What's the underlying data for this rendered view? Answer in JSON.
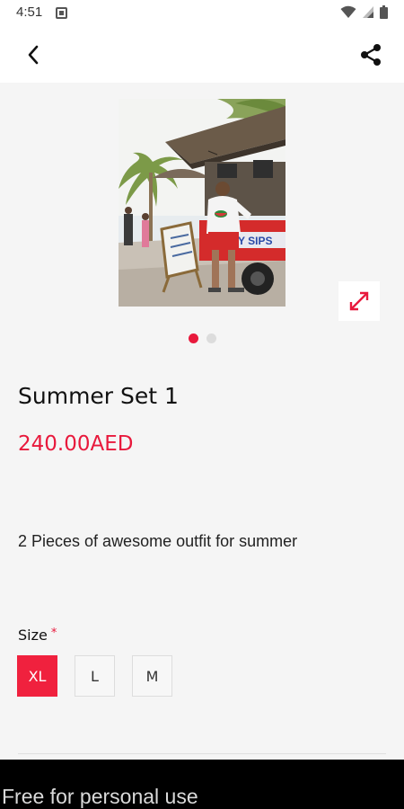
{
  "status_bar": {
    "time": "4:51",
    "icons": [
      "wifi-icon",
      "signal-icon",
      "battery-icon"
    ]
  },
  "app_bar": {
    "back_icon": "chevron-left-icon",
    "share_icon": "share-icon"
  },
  "gallery": {
    "image_alt": "Person at an ICY SIPS drink cart under palm trees",
    "cart_sign_text": "ICY SIPS",
    "expand_icon": "expand-arrows-icon",
    "dot_count": 2,
    "active_dot": 0
  },
  "product": {
    "title": "Summer Set 1",
    "price": "240.00AED",
    "description": "2 Pieces of awesome outfit for summer"
  },
  "size": {
    "label": "Size",
    "required_mark": "*",
    "options": [
      "XL",
      "L",
      "M"
    ],
    "selected": "XL"
  },
  "footer": {
    "watermark": "Free for personal use"
  },
  "colors": {
    "accent": "#e8193c",
    "selected_size_bg": "#f0213e",
    "background": "#f5f5f5"
  }
}
